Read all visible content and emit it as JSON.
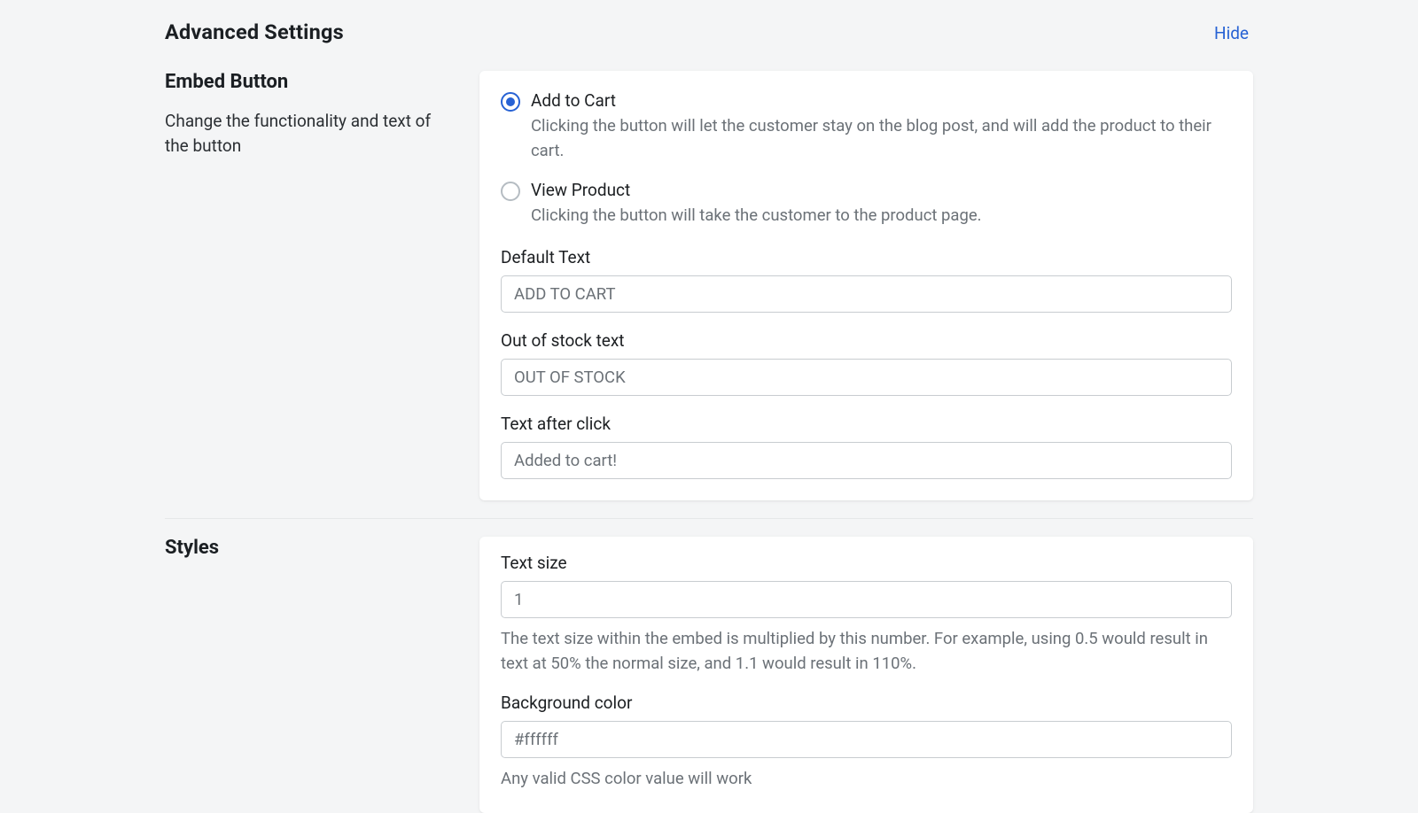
{
  "header": {
    "title": "Advanced Settings",
    "hide_label": "Hide"
  },
  "embed_button": {
    "heading": "Embed Button",
    "description": "Change the functionality and text of the button",
    "radios": {
      "add_to_cart": {
        "label": "Add to Cart",
        "description": "Clicking the button will let the customer stay on the blog post, and will add the product to their cart."
      },
      "view_product": {
        "label": "View Product",
        "description": "Clicking the button will take the customer to the product page."
      }
    },
    "fields": {
      "default_text": {
        "label": "Default Text",
        "value": "ADD TO CART"
      },
      "out_of_stock": {
        "label": "Out of stock text",
        "value": "OUT OF STOCK"
      },
      "after_click": {
        "label": "Text after click",
        "value": "Added to cart!"
      }
    }
  },
  "styles": {
    "heading": "Styles",
    "fields": {
      "text_size": {
        "label": "Text size",
        "value": "1",
        "help": "The text size within the embed is multiplied by this number. For example, using 0.5 would result in text at 50% the normal size, and 1.1 would result in 110%."
      },
      "background_color": {
        "label": "Background color",
        "value": "#ffffff",
        "help": "Any valid CSS color value will work"
      }
    }
  }
}
